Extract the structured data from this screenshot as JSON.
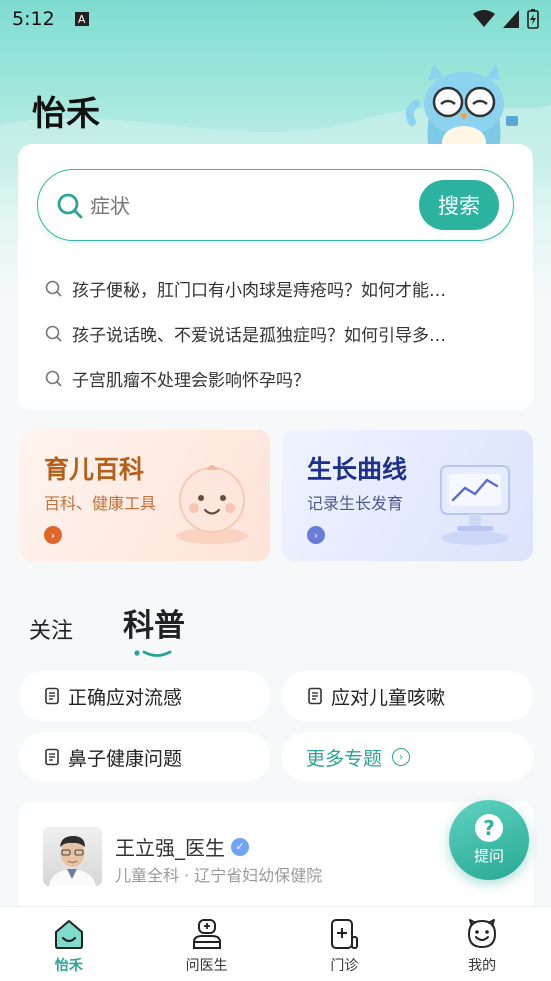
{
  "status_bar": {
    "time": "5:12",
    "notif_icon": "A"
  },
  "app": {
    "title": "怡禾"
  },
  "search": {
    "placeholder": "症状",
    "button_label": "搜索",
    "hot_queries": [
      "孩子便秘，肛门口有小肉球是痔疮吗？如何才能…",
      "孩子说话晚、不爱说话是孤独症吗？如何引导多…",
      "子宫肌瘤不处理会影响怀孕吗？"
    ]
  },
  "tools": [
    {
      "title": "育儿百科",
      "subtitle": "百科、健康工具",
      "title_color": "#b3601a",
      "sub_color": "#c0713c",
      "arrow_color": "#e0672c"
    },
    {
      "title": "生长曲线",
      "subtitle": "记录生长发育",
      "title_color": "#1e2f8c",
      "sub_color": "#4e5a8f",
      "arrow_color": "#6a7bd8"
    }
  ],
  "tabs": {
    "follow": "关注",
    "science": "科普"
  },
  "topics": {
    "t1": "正确应对流感",
    "t2": "应对儿童咳嗽",
    "t3": "鼻子健康问题",
    "more": "更多专题"
  },
  "doctor": {
    "name": "王立强_医生",
    "dept": "儿童全科 · 辽宁省妇幼保健院"
  },
  "fab": {
    "label": "提问",
    "icon": "?"
  },
  "nav": {
    "home": "怡禾",
    "ask": "问医生",
    "clinic": "门诊",
    "me": "我的"
  },
  "colors": {
    "accent": "#2cb39f"
  }
}
